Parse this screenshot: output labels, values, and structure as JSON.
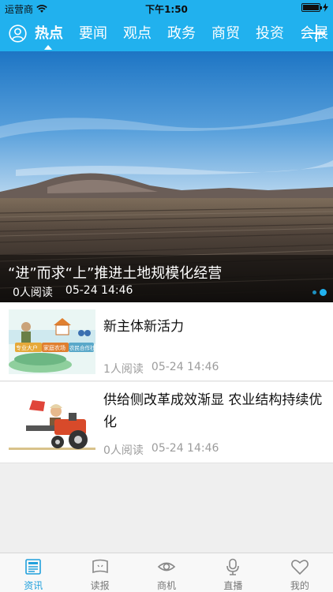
{
  "status_bar": {
    "carrier": "运营商",
    "time": "下午1:50"
  },
  "nav": {
    "tabs": [
      {
        "label": "热点",
        "active": true
      },
      {
        "label": "要闻",
        "active": false
      },
      {
        "label": "观点",
        "active": false
      },
      {
        "label": "政务",
        "active": false
      },
      {
        "label": "商贸",
        "active": false
      },
      {
        "label": "投资",
        "active": false
      },
      {
        "label": "会展",
        "active": false
      }
    ]
  },
  "banner": {
    "title": "“进”而求“上”推进土地规模化经营",
    "reads": "0人阅读",
    "time": "05-24 14:46",
    "page_count": 2,
    "active_page": 2
  },
  "news": [
    {
      "title": "新主体新活力",
      "reads": "1人阅读",
      "time": "05-24 14:46",
      "thumb_labels": [
        "专业大户",
        "家庭农场",
        "农民合作社"
      ]
    },
    {
      "title": "供给侧改革成效渐显 农业结构持续优化",
      "reads": "0人阅读",
      "time": "05-24 14:46"
    }
  ],
  "tab_bar": {
    "tabs": [
      {
        "label": "资讯",
        "icon": "news-icon",
        "active": true
      },
      {
        "label": "读报",
        "icon": "newspaper-icon",
        "active": false
      },
      {
        "label": "商机",
        "icon": "eye-icon",
        "active": false
      },
      {
        "label": "直播",
        "icon": "microphone-icon",
        "active": false
      },
      {
        "label": "我的",
        "icon": "heart-icon",
        "active": false
      }
    ]
  },
  "colors": {
    "accent": "#21b1ee",
    "tab_active": "#21a0dc"
  }
}
